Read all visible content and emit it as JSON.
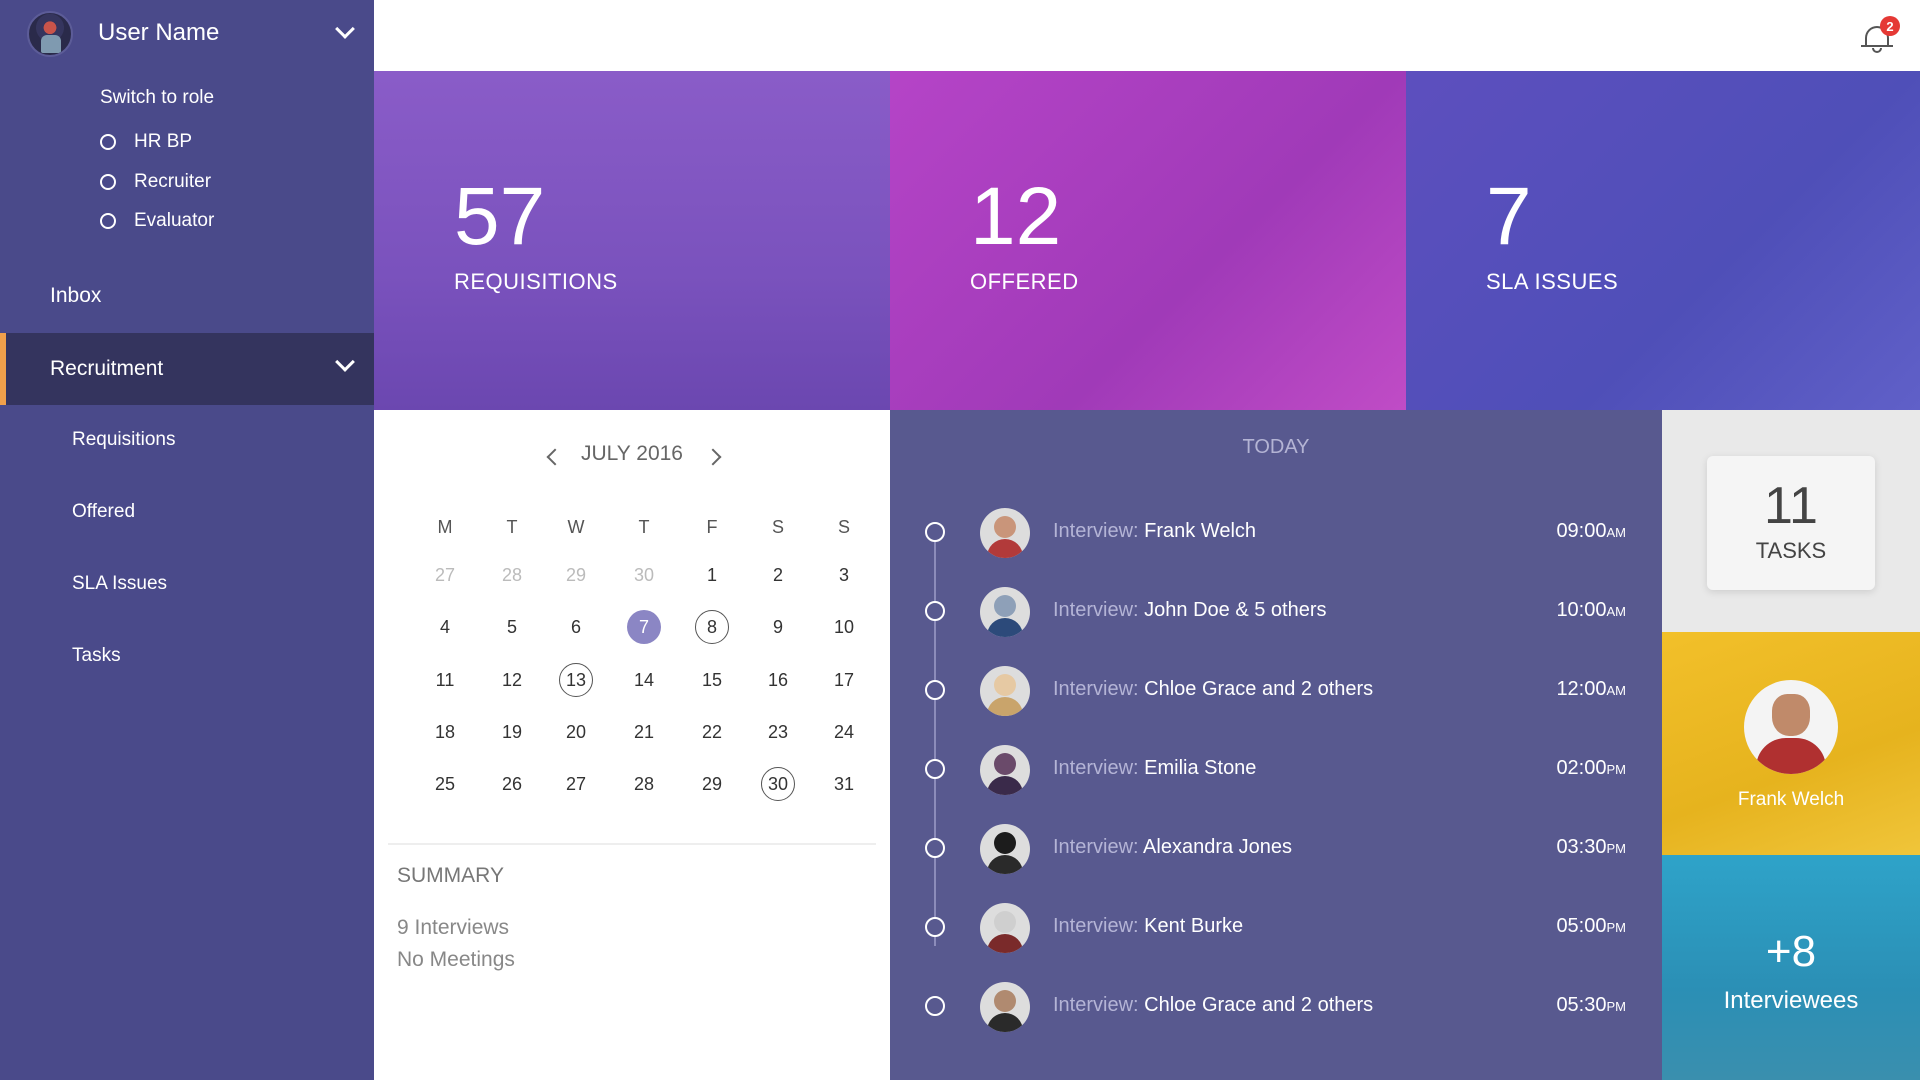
{
  "sidebar": {
    "user_name": "User Name",
    "switch_role_title": "Switch to role",
    "roles": [
      "HR BP",
      "Recruiter",
      "Evaluator"
    ],
    "inbox_label": "Inbox",
    "recruitment_label": "Recruitment",
    "sub_items": [
      "Requisitions",
      "Offered",
      "SLA Issues",
      "Tasks"
    ],
    "accent_color": "#f0a04b"
  },
  "header": {
    "notification_count": "2"
  },
  "stats": [
    {
      "value": "57",
      "label": "REQUISITIONS"
    },
    {
      "value": "12",
      "label": "OFFERED"
    },
    {
      "value": "7",
      "label": "SLA ISSUES"
    }
  ],
  "calendar": {
    "month_label": "JULY 2016",
    "weekdays": [
      "M",
      "T",
      "W",
      "T",
      "F",
      "S",
      "S"
    ],
    "weeks": [
      [
        "27",
        "28",
        "29",
        "30",
        "1",
        "2",
        "3"
      ],
      [
        "4",
        "5",
        "6",
        "7",
        "8",
        "9",
        "10"
      ],
      [
        "11",
        "12",
        "13",
        "14",
        "15",
        "16",
        "17"
      ],
      [
        "18",
        "19",
        "20",
        "21",
        "22",
        "23",
        "24"
      ],
      [
        "25",
        "26",
        "27",
        "28",
        "29",
        "30",
        "31"
      ]
    ],
    "selected_day": "7",
    "marked_days": [
      "8",
      "13",
      "30"
    ],
    "summary_title": "SUMMARY",
    "summary_lines": [
      "9 Interviews",
      "No Meetings"
    ]
  },
  "timeline": {
    "title": "TODAY",
    "events": [
      {
        "prefix": "Interview:",
        "name": "Frank Welch",
        "time": "09:00",
        "ampm": "AM"
      },
      {
        "prefix": "Interview:",
        "name": "John Doe & 5 others",
        "time": "10:00",
        "ampm": "AM"
      },
      {
        "prefix": "Interview:",
        "name": "Chloe Grace and 2 others",
        "time": "12:00",
        "ampm": "AM"
      },
      {
        "prefix": "Interview:",
        "name": "Emilia Stone",
        "time": "02:00",
        "ampm": "PM"
      },
      {
        "prefix": "Interview:",
        "name": "Alexandra Jones",
        "time": "03:30",
        "ampm": "PM"
      },
      {
        "prefix": "Interview:",
        "name": "Kent Burke",
        "time": "05:00",
        "ampm": "PM"
      },
      {
        "prefix": "Interview:",
        "name": "Chloe Grace and 2 others",
        "time": "05:30",
        "ampm": "PM"
      }
    ]
  },
  "tiles": {
    "tasks_count": "11",
    "tasks_label": "TASKS",
    "person_name": "Frank Welch",
    "interviewees_count": "+8",
    "interviewees_label": "Interviewees"
  }
}
